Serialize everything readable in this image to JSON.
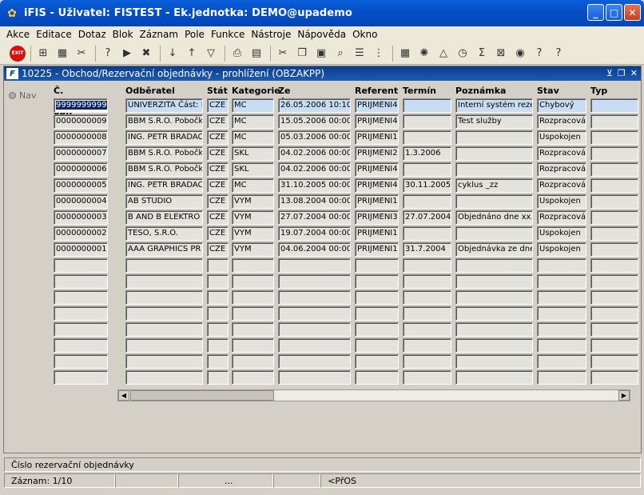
{
  "window": {
    "title": "iFIS - Uživatel: FISTEST - Ek.jednotka: DEMO@upademo"
  },
  "menu": [
    "Akce",
    "Editace",
    "Dotaz",
    "Blok",
    "Záznam",
    "Pole",
    "Funkce",
    "Nástroje",
    "Nápověda",
    "Okno"
  ],
  "toolbar": {
    "exit_label": "EXIT"
  },
  "form": {
    "title": "10225 - Obchod/Rezervační objednávky - prohlížení (OBZAKPP)",
    "nav_label": "Nav"
  },
  "table": {
    "columns": [
      "Č. rez. obj.",
      "Odběratel",
      "Stát",
      "Kategorie",
      "Ze dne",
      "Referent",
      "Termín",
      "Poznámka",
      "Stav",
      "Typ"
    ],
    "rows": [
      [
        "9999999999",
        "UNIVERZITA Část: I",
        "CZE",
        "MC",
        "26.05.2006 10:10",
        "PRIJMENI4",
        "",
        "Interní systém reze",
        "Chybový",
        ""
      ],
      [
        "0000000009",
        "BBM S.R.O. Pobočk",
        "CZE",
        "MC",
        "15.05.2006 00:00",
        "PRIJMENI4",
        "",
        "Test služby",
        "Rozpracová",
        ""
      ],
      [
        "0000000008",
        "ING. PETR BRADAC",
        "CZE",
        "MC",
        "05.03.2006 00:00",
        "PRIJMENI1",
        "",
        "",
        "Uspokojen",
        ""
      ],
      [
        "0000000007",
        "BBM S.R.O. Pobočk",
        "CZE",
        "SKL",
        "04.02.2006 00:00",
        "PRIJMENI2",
        "1.3.2006",
        "",
        "Rozpracová",
        ""
      ],
      [
        "0000000006",
        "BBM S.R.O. Pobočk",
        "CZE",
        "SKL",
        "04.02.2006 00:00",
        "PRIJMENI4",
        "",
        "",
        "Rozpracová",
        ""
      ],
      [
        "0000000005",
        "ING. PETR BRADAC",
        "CZE",
        "MC",
        "31.10.2005 00:00",
        "PRIJMENI4",
        "30.11.2005",
        "cyklus _zz",
        "Rozpracová",
        ""
      ],
      [
        "0000000004",
        "AB STUDIO",
        "CZE",
        "VYM",
        "13.08.2004 00:00",
        "PRIJMENI1",
        "",
        "",
        "Uspokojen",
        ""
      ],
      [
        "0000000003",
        "B AND B ELEKTRO",
        "CZE",
        "VYM",
        "27.07.2004 00:00",
        "PRIJMENI3",
        "27.07.2004",
        "Objednáno dne xx.:",
        "Rozpracová",
        ""
      ],
      [
        "0000000002",
        "TESO, S.R.O.",
        "CZE",
        "VYM",
        "19.07.2004 00:00",
        "PRIJMENI1",
        "",
        "",
        "Uspokojen",
        ""
      ],
      [
        "0000000001",
        "AAA GRAPHICS PR",
        "CZE",
        "VYM",
        "04.06.2004 00:00",
        "PRIJMENI1",
        "31.7.2004",
        "Objednávka ze dne",
        "Uspokojen",
        ""
      ]
    ],
    "empty_rows": 8
  },
  "status": {
    "hint": "Číslo rezervační objednávky",
    "record": "Záznam: 1/10",
    "ellipsis": "...",
    "mode": "<PřOS"
  },
  "colors": {
    "titlebar": "#0550c8",
    "selected": "#0a246a",
    "highlight": "#c8dcf4"
  }
}
